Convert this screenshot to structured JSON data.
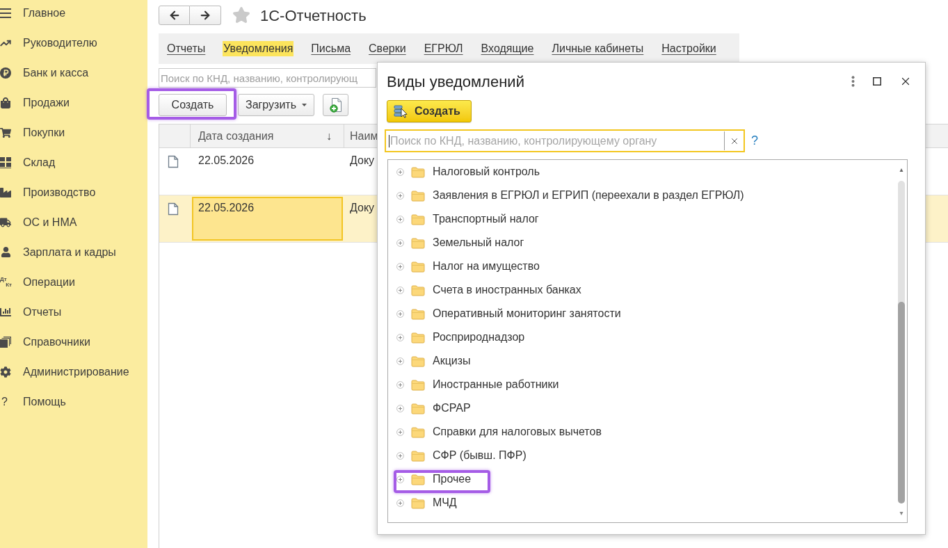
{
  "sidebar": {
    "items": [
      {
        "label": "Главное"
      },
      {
        "label": "Руководителю"
      },
      {
        "label": "Банк и касса"
      },
      {
        "label": "Продажи"
      },
      {
        "label": "Покупки"
      },
      {
        "label": "Склад"
      },
      {
        "label": "Производство"
      },
      {
        "label": "ОС и НМА"
      },
      {
        "label": "Зарплата и кадры"
      },
      {
        "label": "Операции",
        "icon_text": [
          "Дт",
          "Кт"
        ]
      },
      {
        "label": "Отчеты"
      },
      {
        "label": "Справочники"
      },
      {
        "label": "Администрирование"
      },
      {
        "label": "Помощь",
        "icon_text": [
          "?"
        ]
      }
    ]
  },
  "header": {
    "title": "1С-Отчетность",
    "favorite": false
  },
  "tabs": [
    {
      "label": "Отчеты",
      "selected": false
    },
    {
      "label": "Уведомления",
      "selected": true
    },
    {
      "label": "Письма",
      "selected": false
    },
    {
      "label": "Сверки",
      "selected": false
    },
    {
      "label": "ЕГРЮЛ",
      "selected": false
    },
    {
      "label": "Входящие",
      "selected": false
    },
    {
      "label": "Личные кабинеты",
      "selected": false
    },
    {
      "label": "Настройки",
      "selected": false
    }
  ],
  "search": {
    "placeholder": "Поиск по КНД, названию, контролирующ"
  },
  "toolbar": {
    "buttons": [
      {
        "kind": "text",
        "label": "Создать",
        "highlighted": true
      },
      {
        "kind": "dropdown",
        "label": "Загрузить",
        "highlighted": false
      },
      {
        "kind": "icon",
        "highlighted": false
      }
    ]
  },
  "table": {
    "columns": [
      {
        "label": "Дата создания",
        "sort_mark": "↓"
      },
      {
        "label": "Наим"
      }
    ],
    "rows": [
      {
        "date": "22.05.2026",
        "name": "Доку",
        "selected": false
      },
      {
        "date": "22.05.2026",
        "name": "Доку",
        "selected": true
      }
    ]
  },
  "dialog": {
    "title": "Виды уведомлений",
    "create_label": "Создать",
    "search": {
      "placeholder": "Поиск по КНД, названию, контролирующему органу",
      "focused": true
    },
    "help": "?",
    "tree": [
      {
        "label": "Налоговый контроль",
        "expanded": false,
        "highlighted": false
      },
      {
        "label": "Заявления в ЕГРЮЛ и ЕГРИП (переехали в раздел ЕГРЮЛ)",
        "expanded": false,
        "highlighted": false
      },
      {
        "label": "Транспортный налог",
        "expanded": false,
        "highlighted": false
      },
      {
        "label": "Земельный налог",
        "expanded": false,
        "highlighted": false
      },
      {
        "label": "Налог на имущество",
        "expanded": false,
        "highlighted": false
      },
      {
        "label": "Счета в иностранных банках",
        "expanded": false,
        "highlighted": false
      },
      {
        "label": "Оперативный мониторинг занятости",
        "expanded": false,
        "highlighted": false
      },
      {
        "label": "Росприроднадзор",
        "expanded": false,
        "highlighted": false
      },
      {
        "label": "Акцизы",
        "expanded": false,
        "highlighted": false
      },
      {
        "label": "Иностранные работники",
        "expanded": false,
        "highlighted": false
      },
      {
        "label": "ФСРАР",
        "expanded": false,
        "highlighted": false
      },
      {
        "label": "Справки для налоговых вычетов",
        "expanded": false,
        "highlighted": false
      },
      {
        "label": "СФР (бывш. ПФР)",
        "expanded": false,
        "highlighted": false
      },
      {
        "label": "Прочее",
        "expanded": false,
        "highlighted": true
      },
      {
        "label": "МЧД",
        "expanded": false,
        "highlighted": false
      }
    ]
  }
}
